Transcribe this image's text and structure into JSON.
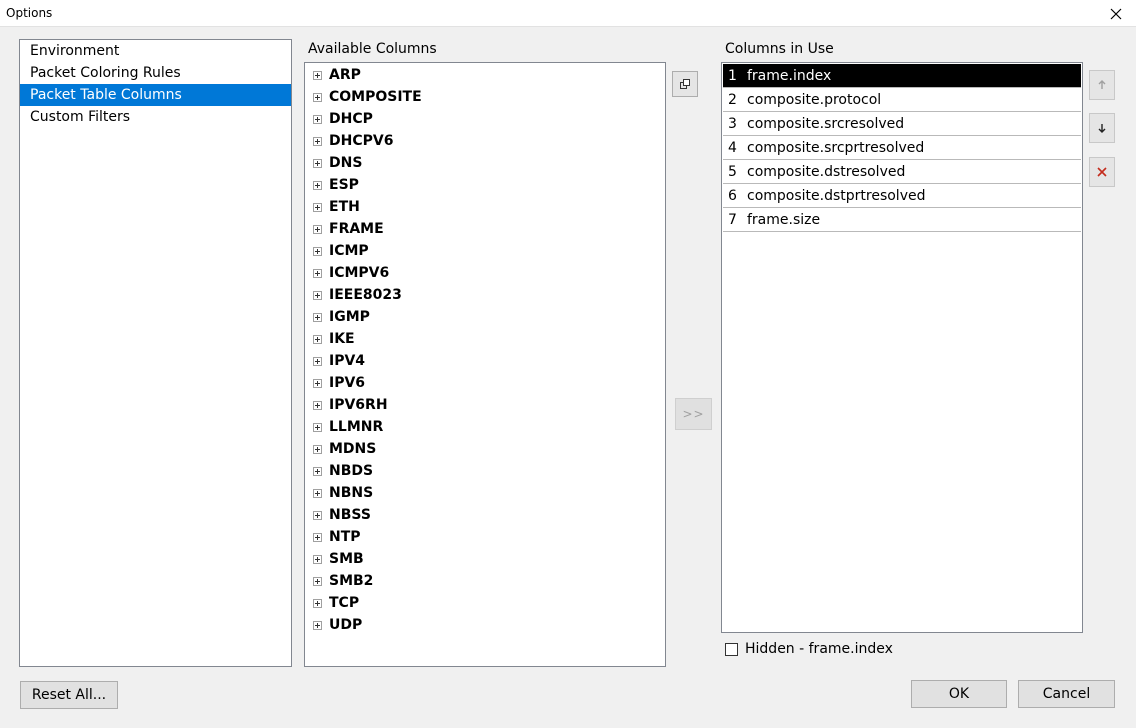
{
  "window": {
    "title": "Options"
  },
  "nav": {
    "items": [
      {
        "label": "Environment"
      },
      {
        "label": "Packet Coloring Rules"
      },
      {
        "label": "Packet Table Columns",
        "selected": true
      },
      {
        "label": "Custom Filters"
      }
    ]
  },
  "available": {
    "label": "Available Columns",
    "items": [
      "ARP",
      "COMPOSITE",
      "DHCP",
      "DHCPV6",
      "DNS",
      "ESP",
      "ETH",
      "FRAME",
      "ICMP",
      "ICMPV6",
      "IEEE8023",
      "IGMP",
      "IKE",
      "IPV4",
      "IPV6",
      "IPV6RH",
      "LLMNR",
      "MDNS",
      "NBDS",
      "NBNS",
      "NBSS",
      "NTP",
      "SMB",
      "SMB2",
      "TCP",
      "UDP"
    ]
  },
  "add_button": {
    "label": ">>"
  },
  "in_use": {
    "label": "Columns in Use",
    "rows": [
      {
        "num": "1",
        "name": "frame.index",
        "selected": true
      },
      {
        "num": "2",
        "name": "composite.protocol"
      },
      {
        "num": "3",
        "name": "composite.srcresolved"
      },
      {
        "num": "4",
        "name": "composite.srcprtresolved"
      },
      {
        "num": "5",
        "name": "composite.dstresolved"
      },
      {
        "num": "6",
        "name": "composite.dstprtresolved"
      },
      {
        "num": "7",
        "name": "frame.size"
      }
    ]
  },
  "hidden": {
    "label": "Hidden - frame.index",
    "checked": false
  },
  "footer": {
    "reset_label": "Reset All...",
    "ok_label": "OK",
    "cancel_label": "Cancel"
  },
  "colors": {
    "selection": "#0078d7",
    "list_selection": "#000000",
    "remove": "#c42b1c"
  }
}
